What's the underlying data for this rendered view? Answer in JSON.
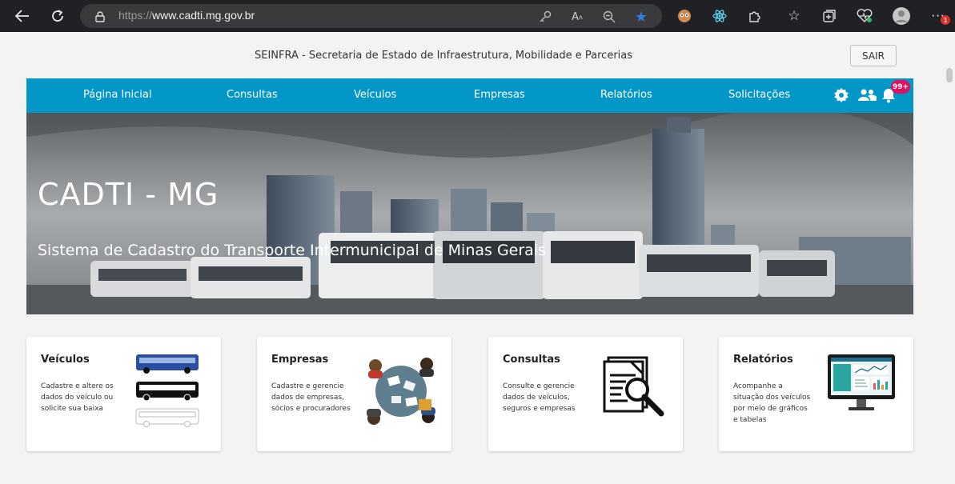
{
  "browser": {
    "url_prefix": "https://",
    "url_host": "www.cadti.mg.gov.br",
    "accent_color": "#2f7fd8"
  },
  "header": {
    "title": "SEINFRA - Secretaria de Estado de Infraestrutura, Mobilidade e Parcerias",
    "logout_label": "SAIR"
  },
  "nav": {
    "color": "#0397c7",
    "items": [
      {
        "label": "Página Inicial"
      },
      {
        "label": "Consultas"
      },
      {
        "label": "Veículos"
      },
      {
        "label": "Empresas"
      },
      {
        "label": "Relatórios"
      },
      {
        "label": "Solicitações"
      }
    ],
    "icons": [
      "gear-icon",
      "people-icon",
      "bell-icon"
    ],
    "notification_badge": "99+"
  },
  "hero": {
    "title": "CADTI - MG",
    "subtitle": "Sistema de Cadastro do Transporte Intermunicipal de Minas Gerais"
  },
  "cards": [
    {
      "title": "Veículos",
      "description": "Cadastre e altere os dados do veículo ou solicite sua baixa",
      "icon": "buses-icon"
    },
    {
      "title": "Empresas",
      "description": "Cadastre e gerencie dados de empresas, sócios e procuradores",
      "icon": "meeting-table-icon"
    },
    {
      "title": "Consultas",
      "description": "Consulte e gerencie dados de veículos, seguros e empresas",
      "icon": "document-search-icon"
    },
    {
      "title": "Relatórios",
      "description": "Acompanhe a situação dos veículos por meio de gráficos e tabelas",
      "icon": "monitor-dashboard-icon"
    }
  ]
}
